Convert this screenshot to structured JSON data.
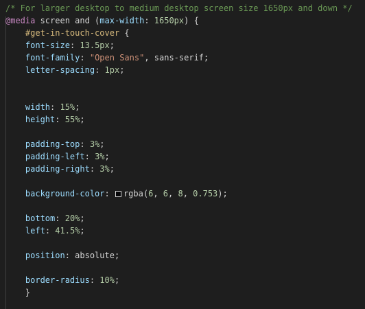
{
  "editor": {
    "language": "css",
    "swatch_color": "#060608",
    "lines": [
      [
        {
          "t": "/* For larger desktop to medium desktop screen size 1650px and down */",
          "k": "comment"
        }
      ],
      [
        {
          "t": "@media",
          "k": "at"
        },
        {
          "t": " screen and (",
          "k": "plain"
        },
        {
          "t": "max-width",
          "k": "prop"
        },
        {
          "t": ": ",
          "k": "plain"
        },
        {
          "t": "1650px",
          "k": "num"
        },
        {
          "t": ") {",
          "k": "plain"
        }
      ],
      [
        {
          "t": "    ",
          "k": "plain"
        },
        {
          "t": "#get-in-touch-cover",
          "k": "selector"
        },
        {
          "t": " {",
          "k": "plain"
        }
      ],
      [
        {
          "t": "    ",
          "k": "plain"
        },
        {
          "t": "font-size",
          "k": "prop"
        },
        {
          "t": ": ",
          "k": "plain"
        },
        {
          "t": "13.5px",
          "k": "num"
        },
        {
          "t": ";",
          "k": "plain"
        }
      ],
      [
        {
          "t": "    ",
          "k": "plain"
        },
        {
          "t": "font-family",
          "k": "prop"
        },
        {
          "t": ": ",
          "k": "plain"
        },
        {
          "t": "\"Open Sans\"",
          "k": "str"
        },
        {
          "t": ", sans-serif;",
          "k": "plain"
        }
      ],
      [
        {
          "t": "    ",
          "k": "plain"
        },
        {
          "t": "letter-spacing",
          "k": "prop"
        },
        {
          "t": ": ",
          "k": "plain"
        },
        {
          "t": "1px",
          "k": "num"
        },
        {
          "t": ";",
          "k": "plain"
        }
      ],
      [],
      [],
      [
        {
          "t": "    ",
          "k": "plain"
        },
        {
          "t": "width",
          "k": "prop"
        },
        {
          "t": ": ",
          "k": "plain"
        },
        {
          "t": "15%",
          "k": "num"
        },
        {
          "t": ";",
          "k": "plain"
        }
      ],
      [
        {
          "t": "    ",
          "k": "plain"
        },
        {
          "t": "height",
          "k": "prop"
        },
        {
          "t": ": ",
          "k": "plain"
        },
        {
          "t": "55%",
          "k": "num"
        },
        {
          "t": ";",
          "k": "plain"
        }
      ],
      [],
      [
        {
          "t": "    ",
          "k": "plain"
        },
        {
          "t": "padding-top",
          "k": "prop"
        },
        {
          "t": ": ",
          "k": "plain"
        },
        {
          "t": "3%",
          "k": "num"
        },
        {
          "t": ";",
          "k": "plain"
        }
      ],
      [
        {
          "t": "    ",
          "k": "plain"
        },
        {
          "t": "padding-left",
          "k": "prop"
        },
        {
          "t": ": ",
          "k": "plain"
        },
        {
          "t": "3%",
          "k": "num"
        },
        {
          "t": ";",
          "k": "plain"
        }
      ],
      [
        {
          "t": "    ",
          "k": "plain"
        },
        {
          "t": "padding-right",
          "k": "prop"
        },
        {
          "t": ": ",
          "k": "plain"
        },
        {
          "t": "3%",
          "k": "num"
        },
        {
          "t": ";",
          "k": "plain"
        }
      ],
      [],
      [
        {
          "t": "    ",
          "k": "plain"
        },
        {
          "t": "background-color",
          "k": "prop"
        },
        {
          "t": ": ",
          "k": "plain"
        },
        {
          "t": "",
          "k": "swatch"
        },
        {
          "t": "rgba(",
          "k": "plain"
        },
        {
          "t": "6",
          "k": "num"
        },
        {
          "t": ", ",
          "k": "plain"
        },
        {
          "t": "6",
          "k": "num"
        },
        {
          "t": ", ",
          "k": "plain"
        },
        {
          "t": "8",
          "k": "num"
        },
        {
          "t": ", ",
          "k": "plain"
        },
        {
          "t": "0.753",
          "k": "num"
        },
        {
          "t": ");",
          "k": "plain"
        }
      ],
      [],
      [
        {
          "t": "    ",
          "k": "plain"
        },
        {
          "t": "bottom",
          "k": "prop"
        },
        {
          "t": ": ",
          "k": "plain"
        },
        {
          "t": "20%",
          "k": "num"
        },
        {
          "t": ";",
          "k": "plain"
        }
      ],
      [
        {
          "t": "    ",
          "k": "plain"
        },
        {
          "t": "left",
          "k": "prop"
        },
        {
          "t": ": ",
          "k": "plain"
        },
        {
          "t": "41.5%",
          "k": "num"
        },
        {
          "t": ";",
          "k": "plain"
        }
      ],
      [],
      [
        {
          "t": "    ",
          "k": "plain"
        },
        {
          "t": "position",
          "k": "prop"
        },
        {
          "t": ": ",
          "k": "plain"
        },
        {
          "t": "absolute",
          "k": "plain"
        },
        {
          "t": ";",
          "k": "plain"
        }
      ],
      [],
      [
        {
          "t": "    ",
          "k": "plain"
        },
        {
          "t": "border-radius",
          "k": "prop"
        },
        {
          "t": ": ",
          "k": "plain"
        },
        {
          "t": "10%",
          "k": "num"
        },
        {
          "t": ";",
          "k": "plain"
        }
      ],
      [
        {
          "t": "    }",
          "k": "plain"
        }
      ]
    ]
  }
}
